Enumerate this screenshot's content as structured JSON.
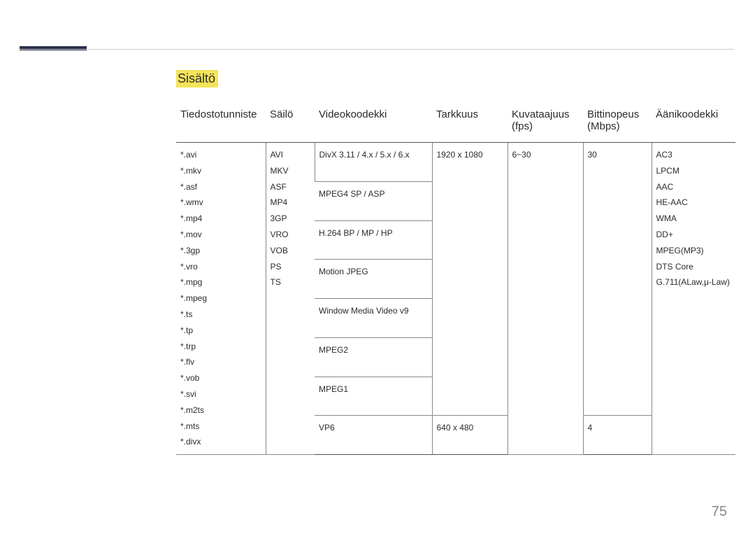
{
  "heading": "Sisältö",
  "page_number": "75",
  "headers": {
    "ext": "Tiedostotunniste",
    "cont": "Säilö",
    "codec": "Videokoodekki",
    "res": "Tarkkuus",
    "fps": "Kuvataajuus (fps)",
    "bit": "Bittinopeus (Mbps)",
    "audio": "Äänikoodekki"
  },
  "ext_list": [
    "*.avi",
    "*.mkv",
    "*.asf",
    "*.wmv",
    "*.mp4",
    "*.mov",
    "*.3gp",
    "*.vro",
    "*.mpg",
    "*.mpeg",
    "*.ts",
    "*.tp",
    "*.trp",
    "*.flv",
    "*.vob",
    "*.svi",
    "*.m2ts",
    "*.mts",
    "*.divx"
  ],
  "cont_list": [
    "AVI",
    "MKV",
    "ASF",
    "MP4",
    "3GP",
    "VRO",
    "VOB",
    "PS",
    "TS"
  ],
  "audio_list": [
    "AC3",
    "LPCM",
    "AAC",
    "HE-AAC",
    "WMA",
    "DD+",
    "MPEG(MP3)",
    "DTS Core",
    "G.711(ALaw,μ-Law)"
  ],
  "codec_rows": [
    {
      "codec": "DivX 3.11 / 4.x / 5.x / 6.x",
      "res": "1920 x 1080",
      "fps": "6~30",
      "bit": "30"
    },
    {
      "codec": "MPEG4 SP / ASP"
    },
    {
      "codec": "H.264 BP / MP / HP"
    },
    {
      "codec": "Motion JPEG"
    },
    {
      "codec": "Window Media Video v9"
    },
    {
      "codec": "MPEG2"
    },
    {
      "codec": "MPEG1"
    },
    {
      "codec": "VP6",
      "res": "640 x 480",
      "bit": "4"
    }
  ]
}
